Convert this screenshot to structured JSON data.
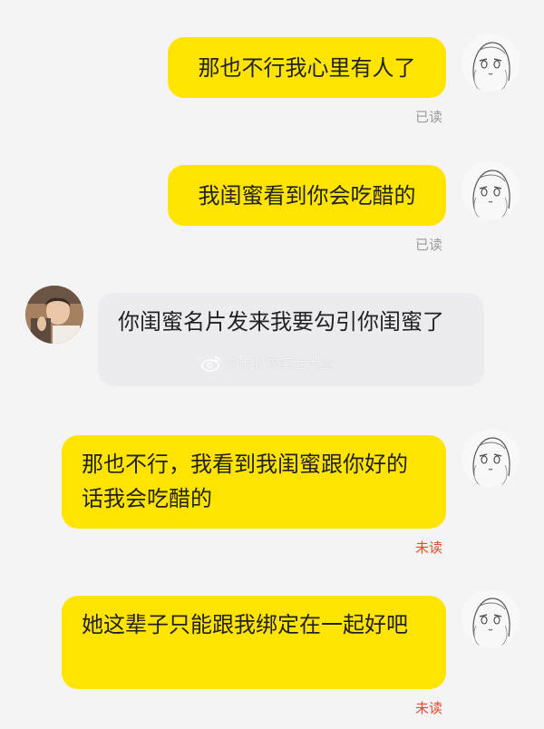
{
  "messages": [
    {
      "sender": "me",
      "text": "那也不行我心里有人了",
      "status": "已读"
    },
    {
      "sender": "me",
      "text": "我闺蜜看到你会吃醋的",
      "status": "已读"
    },
    {
      "sender": "other",
      "text": "你闺蜜名片发来我要勾引你闺蜜了"
    },
    {
      "sender": "me",
      "text": "那也不行，我看到我闺蜜跟你好的话我会吃醋的",
      "status": "未读"
    },
    {
      "sender": "me",
      "text": "她这辈子只能跟我绑定在一起好吧",
      "status": "未读"
    }
  ],
  "watermark": {
    "text": "@出收物笑话大赏",
    "icon": "weibo-icon"
  },
  "colors": {
    "my_bubble": "#ffe400",
    "their_bubble": "#ececf0",
    "unread_status": "#e24a2a",
    "read_status": "#9a9a9a",
    "background": "#f4f4f4"
  }
}
